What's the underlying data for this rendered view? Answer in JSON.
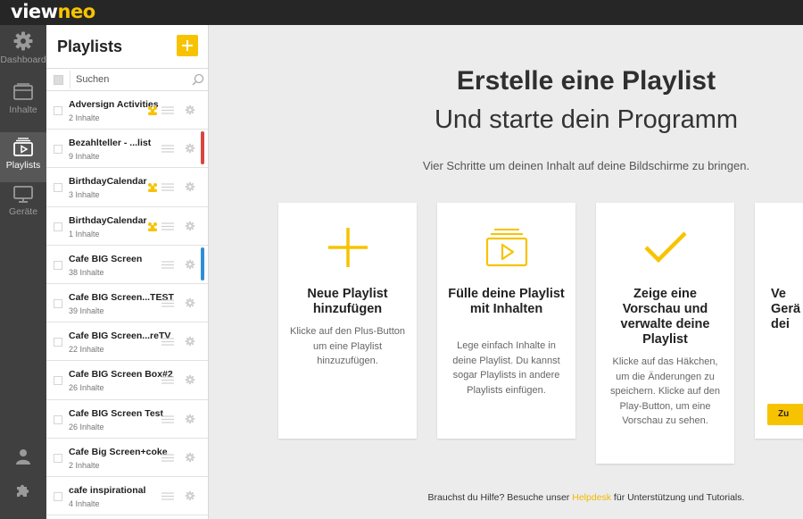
{
  "app": {
    "logo_part1": "view",
    "logo_part2": "neo"
  },
  "nav": {
    "items": [
      {
        "label": "Dashboard",
        "icon": "gear-icon"
      },
      {
        "label": "Inhalte",
        "icon": "folder-icon"
      },
      {
        "label": "Playlists",
        "icon": "playlist-icon"
      },
      {
        "label": "Geräte",
        "icon": "monitor-icon"
      }
    ],
    "active": "Playlists",
    "bottom_icons": [
      "user-icon",
      "puzzle-icon"
    ]
  },
  "playlists_panel": {
    "title": "Playlists",
    "search_placeholder": "Suchen",
    "items": [
      {
        "name": "Adversign Activities",
        "count": "2 Inhalte",
        "shared": true,
        "marker": ""
      },
      {
        "name": "Bezahlteller - ...list",
        "count": "9 Inhalte",
        "shared": false,
        "marker": "#d9463e"
      },
      {
        "name": "BirthdayCalendar",
        "count": "3 Inhalte",
        "shared": true,
        "marker": ""
      },
      {
        "name": "BirthdayCalendar",
        "count": "1 Inhalte",
        "shared": true,
        "marker": ""
      },
      {
        "name": "Cafe BIG Screen",
        "count": "38 Inhalte",
        "shared": false,
        "marker": "#2e8fd6"
      },
      {
        "name": "Cafe BIG Screen...TEST",
        "count": "39 Inhalte",
        "shared": false,
        "marker": ""
      },
      {
        "name": "Cafe BIG Screen...reTV",
        "count": "22 Inhalte",
        "shared": false,
        "marker": ""
      },
      {
        "name": "Cafe BIG Screen Box#2",
        "count": "26 Inhalte",
        "shared": false,
        "marker": ""
      },
      {
        "name": "Cafe BIG Screen Test",
        "count": "26 Inhalte",
        "shared": false,
        "marker": ""
      },
      {
        "name": "Cafe Big Screen+coke",
        "count": "2 Inhalte",
        "shared": false,
        "marker": ""
      },
      {
        "name": "cafe inspirational",
        "count": "4 Inhalte",
        "shared": false,
        "marker": ""
      }
    ]
  },
  "main": {
    "heading": "Erstelle eine Playlist",
    "subheading": "Und starte dein Programm",
    "lead": "Vier Schritte um deinen Inhalt auf deine Bildschirme zu bringen.",
    "cards": [
      {
        "icon": "plus-icon",
        "title": "Neue Playlist hinzufügen",
        "text": "Klicke auf den Plus-Button um eine Playlist hinzuzufügen."
      },
      {
        "icon": "playlist-icon",
        "title": "Fülle deine Playlist mit Inhalten",
        "text": "Lege einfach Inhalte in deine Playlist. Du kannst sogar Playlists in andere Playlists einfügen."
      },
      {
        "icon": "checkmark-icon",
        "title": "Zeige eine Vorschau und verwalte deine Playlist",
        "text": "Klicke auf das Häkchen, um die Änderungen zu speichern. Klicke auf den Play-Button, um eine Vorschau zu sehen."
      },
      {
        "icon": "",
        "title": "Ve\nGerä\ndei",
        "text": "",
        "button": "Zu"
      }
    ],
    "help_before": "Brauchst du Hilfe? Besuche unser ",
    "help_link": "Helpdesk",
    "help_after": " für Unterstützung und Tutorials."
  },
  "colors": {
    "accent": "#f7c300",
    "topbar": "#262626",
    "rail": "#404040",
    "rail_active": "#575757"
  }
}
